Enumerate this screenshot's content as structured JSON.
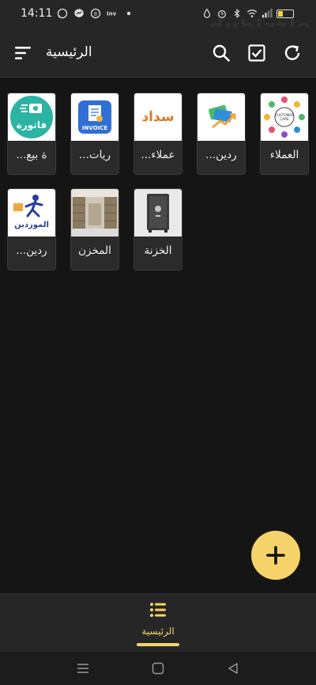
{
  "status_bar": {
    "time": "14:11",
    "left_icons": [
      "whatsapp-icon",
      "messenger-icon",
      "whatsapp-business-icon",
      "inv-app-icon",
      "dot-icon"
    ],
    "right_icons": [
      "data-saver-icon",
      "alarm-icon",
      "bluetooth-icon",
      "wifi-icon",
      "signal-icon",
      "battery-icon"
    ],
    "watermark": "dubizzle"
  },
  "appbar": {
    "title": "الرئيسية",
    "icons": [
      "menu-icon",
      "search-icon",
      "checkbox-icon",
      "refresh-icon"
    ]
  },
  "tiles": [
    {
      "label": "العملاء",
      "icon": "customer-care-image"
    },
    {
      "label": "...ردين",
      "icon": "money-payment-image"
    },
    {
      "label": "...عملاء",
      "icon": "sadad-logo"
    },
    {
      "label": "...ريات",
      "icon": "invoice-app-image"
    },
    {
      "label": "...ة بيع",
      "icon": "fatoora-logo"
    },
    {
      "label": "الخزنة",
      "icon": "safe-image"
    },
    {
      "label": "المخزن",
      "icon": "warehouse-image"
    },
    {
      "label": "...ردين",
      "icon": "suppliers-logo"
    }
  ],
  "tile_text": {
    "fatoora": "فاتورة",
    "invoice": "INVOICE",
    "sadad": "سداد",
    "customer_care": "CUSTOMER CARE",
    "suppliers": "الموردين"
  },
  "fab": {
    "icon": "plus-icon"
  },
  "bottom_nav": {
    "label": "الرئيسية",
    "icon": "list-icon"
  },
  "system_nav": [
    "recents-icon",
    "home-icon",
    "back-icon"
  ],
  "colors": {
    "accent": "#f6d36a",
    "background": "#151515",
    "bar": "#262626",
    "tile": "#2b2b2b"
  }
}
